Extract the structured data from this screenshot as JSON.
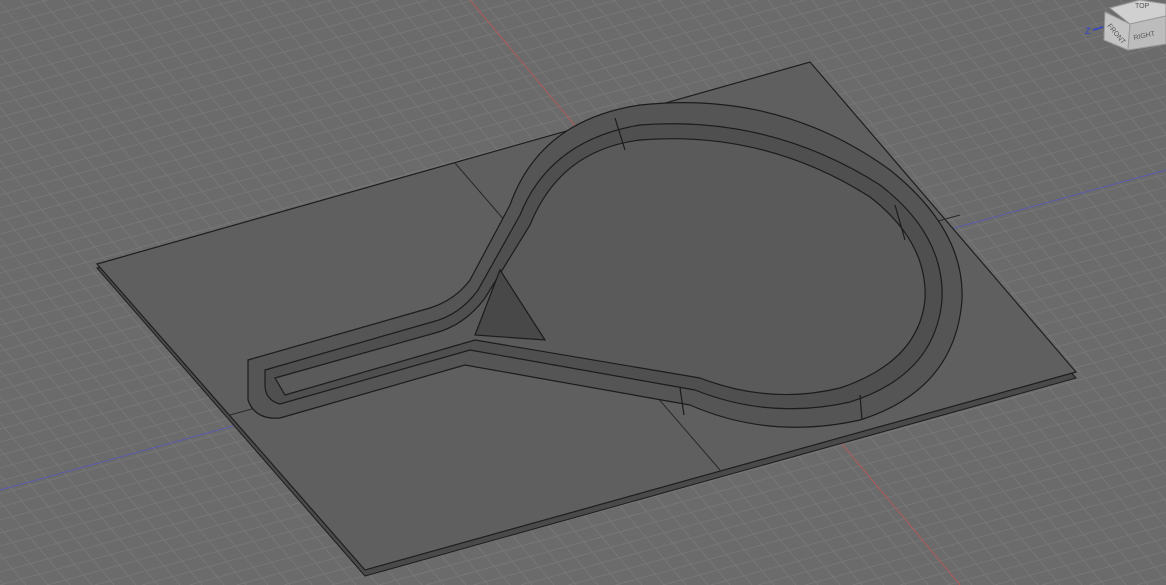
{
  "viewport": {
    "background": "#6b6b6b",
    "grid_color": "#7a7a7a",
    "x_axis_color": "#b05050",
    "y_axis_color": "#5050b0"
  },
  "model": {
    "plate_color": "#5e5e5e",
    "edge_color": "#1e1e1e"
  },
  "viewcube": {
    "top": "TOP",
    "front": "FRONT",
    "right": "RIGHT",
    "axis_z": "Z"
  }
}
